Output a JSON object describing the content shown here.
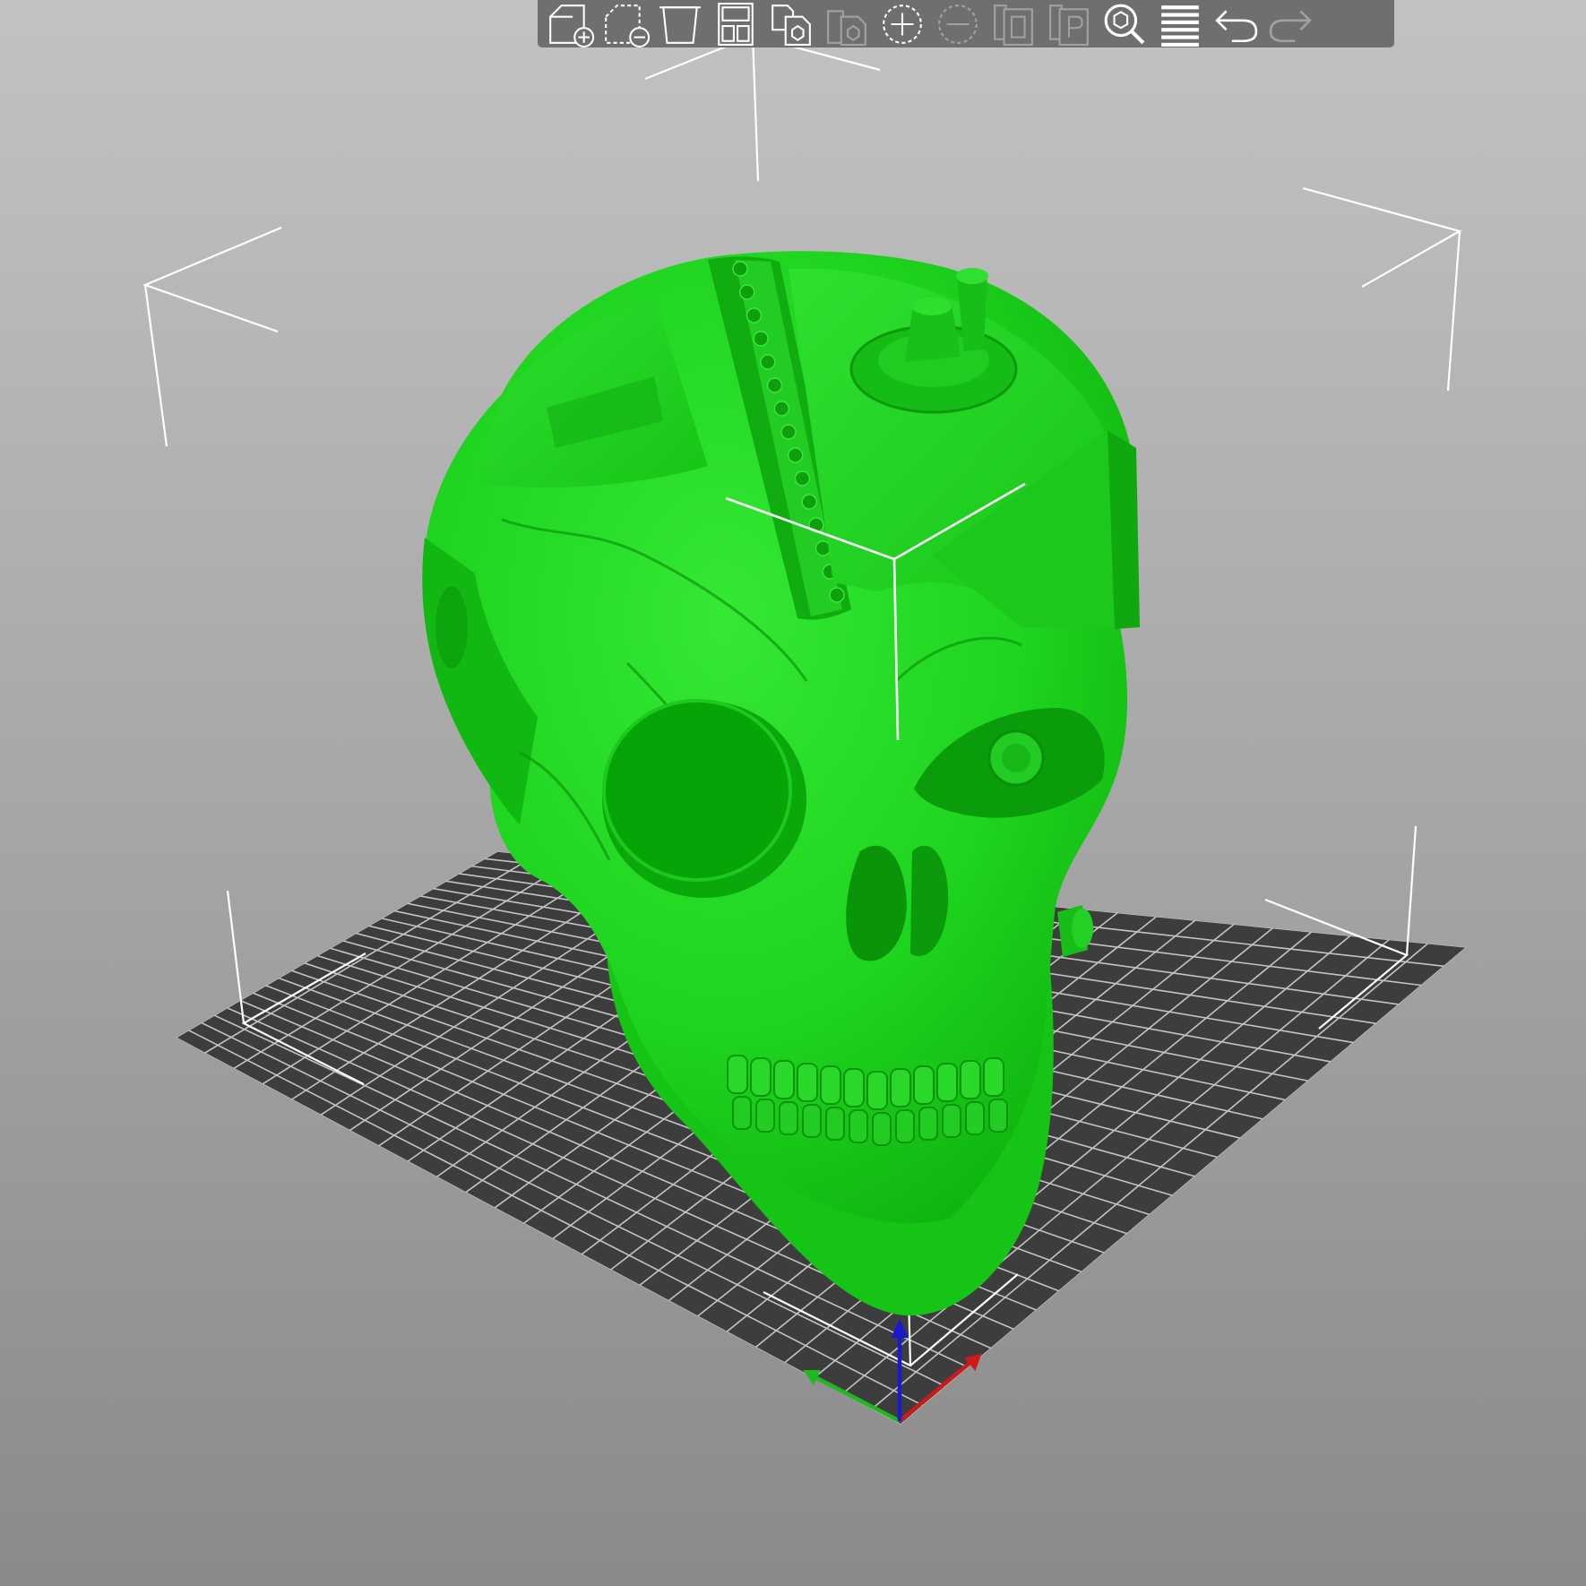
{
  "app": {
    "view": "3D plater"
  },
  "colors": {
    "model": "#1ed41e",
    "model_dark": "#0aa00a",
    "bed": "#3d3d3d",
    "bed_grid": "#e6e6e6",
    "bbox_lines": "#ffffff",
    "axis_x": "#cc1a1a",
    "axis_y": "#1fb81f",
    "axis_z": "#1a1acc",
    "toolbar_bg": "#6f6f6f"
  },
  "toolbar": {
    "buttons": [
      {
        "icon": "add-object-icon",
        "enabled": true
      },
      {
        "icon": "delete-object-icon",
        "enabled": true
      },
      {
        "icon": "delete-all-icon",
        "enabled": true
      },
      {
        "icon": "arrange-icon",
        "enabled": true
      },
      {
        "icon": "copy-icon",
        "enabled": true
      },
      {
        "icon": "paste-icon",
        "enabled": false
      },
      {
        "icon": "add-instance-icon",
        "enabled": true
      },
      {
        "icon": "remove-instance-icon",
        "enabled": false
      },
      {
        "icon": "split-to-objects-icon",
        "enabled": false
      },
      {
        "icon": "split-to-parts-icon",
        "enabled": false
      },
      {
        "icon": "search-icon",
        "enabled": true
      },
      {
        "icon": "layers-icon",
        "enabled": true
      },
      {
        "icon": "undo-icon",
        "enabled": true
      },
      {
        "icon": "redo-icon",
        "enabled": false
      }
    ]
  },
  "model": {
    "name": "cyber-skull",
    "selected": true
  }
}
